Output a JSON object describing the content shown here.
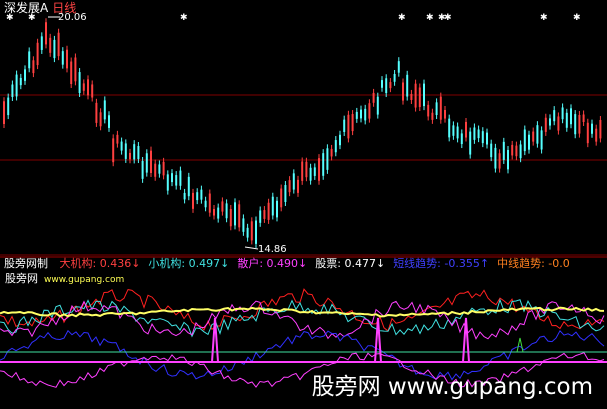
{
  "header": {
    "stock_name": "深发展A",
    "period": "日线"
  },
  "price_labels": {
    "high": "20.06",
    "low": "14.86"
  },
  "indicator": {
    "name": "股旁网制",
    "items": [
      {
        "label": "大机构:",
        "value": "0.436",
        "arrow": "↓",
        "color": "#ff4040"
      },
      {
        "label": "小机构:",
        "value": "0.497",
        "arrow": "↓",
        "color": "#40e0e0"
      },
      {
        "label": "散户:",
        "value": "0.490",
        "arrow": "↓",
        "color": "#ff40ff"
      },
      {
        "label": "股票:",
        "value": "0.477",
        "arrow": "↓",
        "color": "#ffffff"
      },
      {
        "label": "短线趋势:",
        "value": "-0.355",
        "arrow": "↑",
        "color": "#4040ff"
      },
      {
        "label": "中线趋势:",
        "value": "-0.0",
        "arrow": "",
        "color": "#ff8020"
      }
    ]
  },
  "sub_header": {
    "site_name": "股旁网",
    "url": "www.gupang.com"
  },
  "watermark": "股旁网 www.gupang.com",
  "colors": {
    "up_candle": "#ff4040",
    "down_candle": "#55ffff",
    "grid": "#800000",
    "yellow_line": "#ffff66",
    "magenta": "#ff40ff",
    "blue": "#3030ff",
    "red": "#ff2020",
    "cyan": "#40e0e0"
  }
}
